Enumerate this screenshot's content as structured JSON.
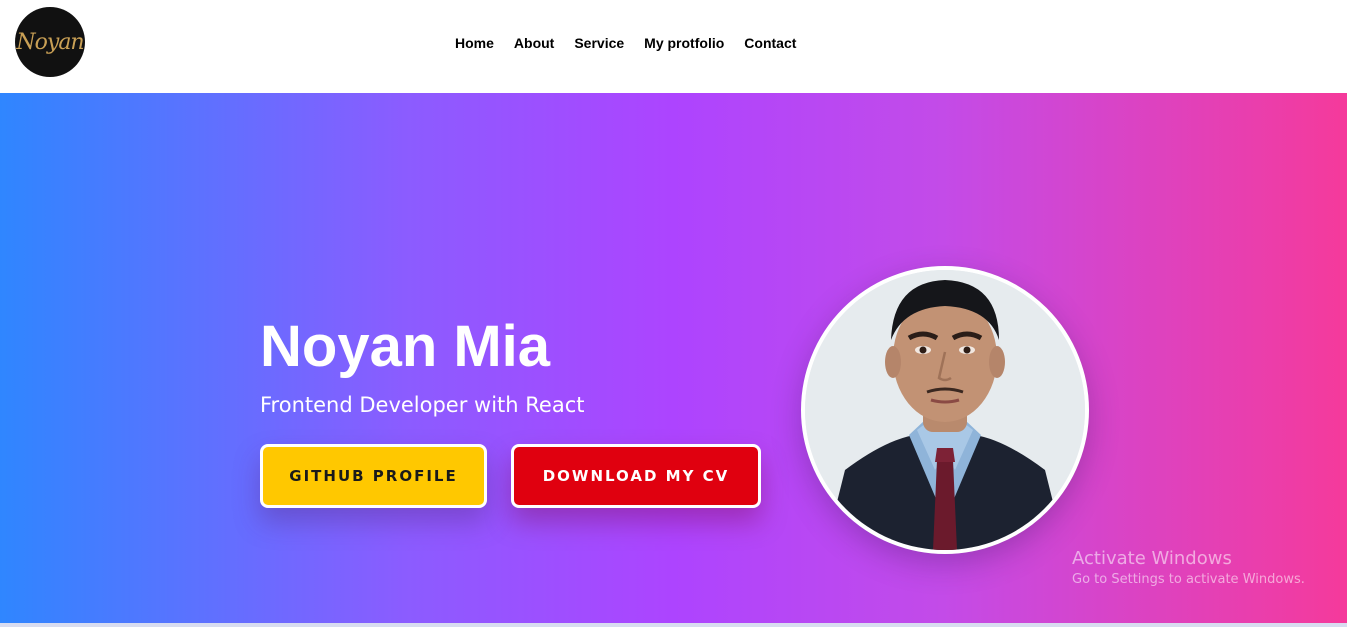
{
  "brand": {
    "logo_text": "Noyan"
  },
  "nav": {
    "items": [
      {
        "label": "Home"
      },
      {
        "label": "About"
      },
      {
        "label": "Service"
      },
      {
        "label": "My protfolio"
      },
      {
        "label": "Contact"
      }
    ]
  },
  "hero": {
    "name": "Noyan Mia",
    "subtitle": "Frontend Developer with React",
    "github_button": "GITHUB PROFILE",
    "cv_button": "DOWNLOAD MY CV"
  },
  "watermark": {
    "title": "Activate Windows",
    "subtitle": "Go to Settings to activate Windows."
  },
  "colors": {
    "gradient_start": "#2f86ff",
    "gradient_mid": "#ad44ff",
    "gradient_end": "#f53a9b",
    "github_button_bg": "#ffc800",
    "cv_button_bg": "#e0000f",
    "logo_gold": "#c9a055"
  }
}
